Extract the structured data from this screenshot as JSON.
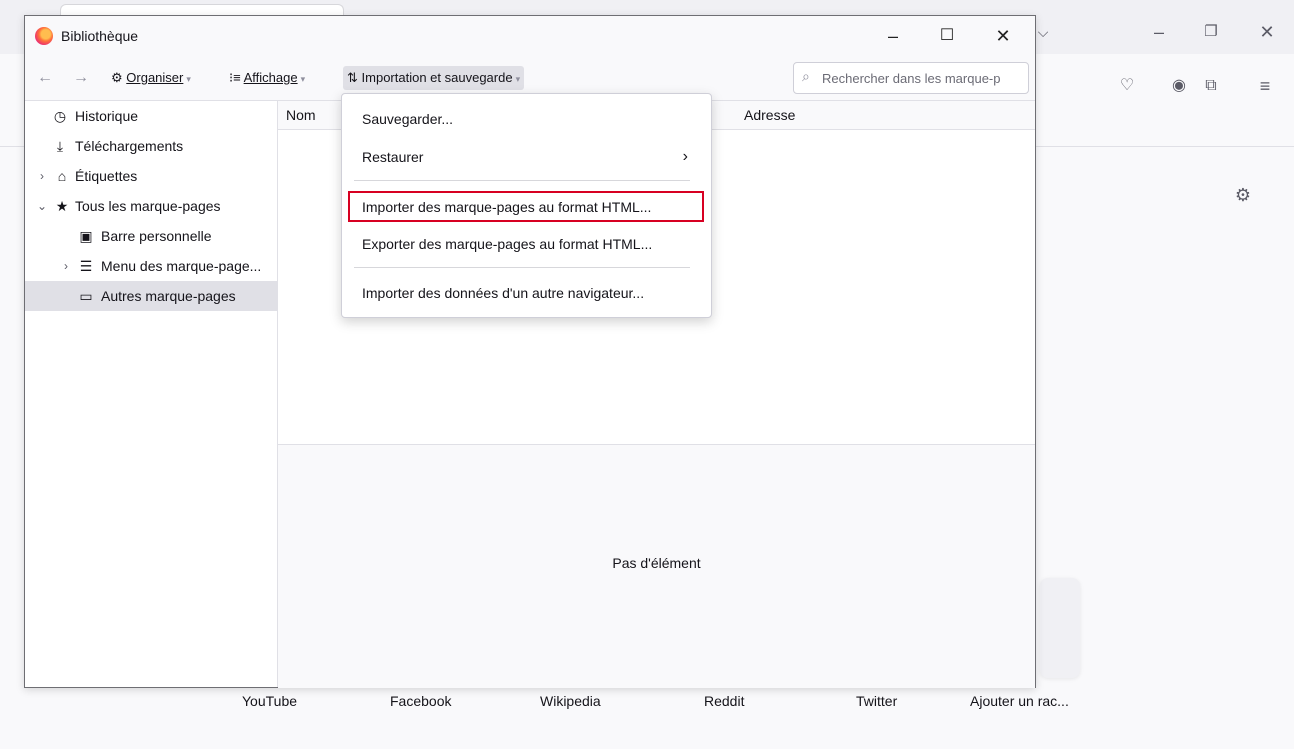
{
  "browser": {
    "shortcuts": [
      "YouTube",
      "Facebook",
      "Wikipedia",
      "Reddit",
      "Twitter",
      "Ajouter un rac..."
    ]
  },
  "window": {
    "title": "Bibliothèque"
  },
  "toolbar": {
    "organize": "Organiser",
    "view": "Affichage",
    "import_backup": "Importation et sauvegarde",
    "search_placeholder": "Rechercher dans les marque-p"
  },
  "sidebar": {
    "items": [
      {
        "label": "Historique"
      },
      {
        "label": "Téléchargements"
      },
      {
        "label": "Étiquettes"
      },
      {
        "label": "Tous les marque-pages"
      },
      {
        "label": "Barre personnelle"
      },
      {
        "label": "Menu des marque-page..."
      },
      {
        "label": "Autres marque-pages"
      }
    ]
  },
  "columns": {
    "name": "Nom",
    "address": "Adresse"
  },
  "empty_text": "Pas d'élément",
  "menu": {
    "backup": "Sauvegarder...",
    "restore": "Restaurer",
    "import_html": "Importer des marque-pages au format HTML...",
    "export_html": "Exporter des marque-pages au format HTML...",
    "import_other": "Importer des données d'un autre navigateur..."
  },
  "colors": {
    "highlight_border": "#d70022",
    "selected_bg": "#e0e0e6"
  }
}
